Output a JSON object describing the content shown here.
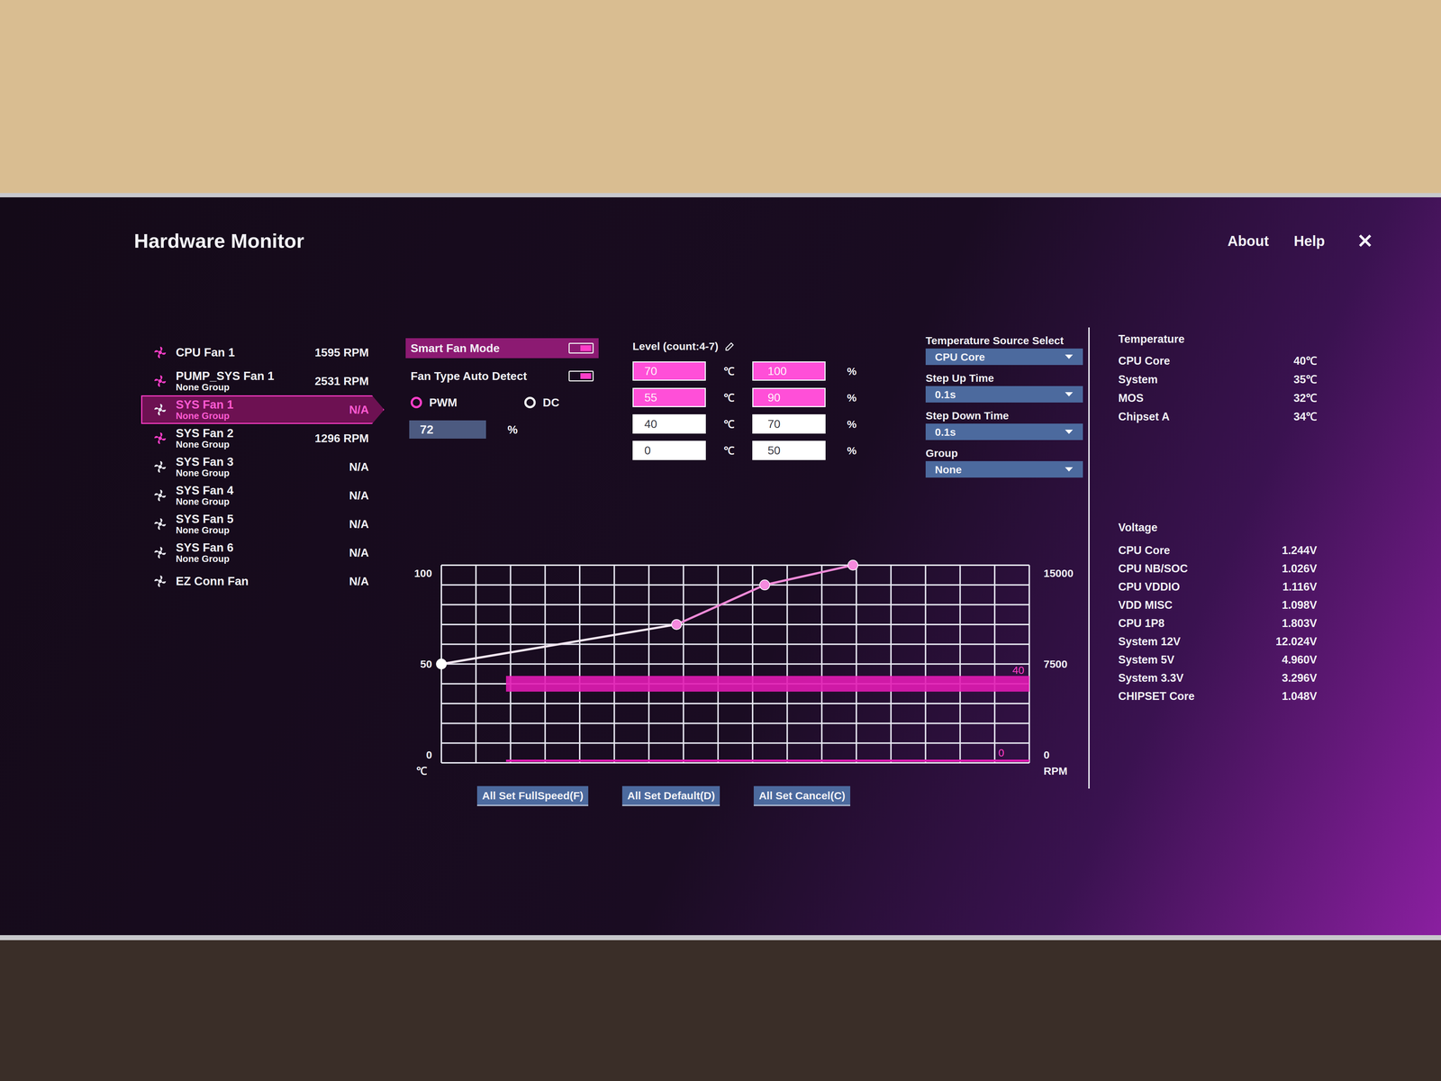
{
  "window": {
    "title": "Hardware Monitor",
    "links": [
      "About",
      "Help"
    ],
    "close": "✕"
  },
  "fans": [
    {
      "name": "CPU Fan 1",
      "group": "",
      "rpm": "1595 RPM",
      "detected": true,
      "selected": false
    },
    {
      "name": "PUMP_SYS Fan 1",
      "group": "None Group",
      "rpm": "2531 RPM",
      "detected": true,
      "selected": false
    },
    {
      "name": "SYS Fan 1",
      "group": "None Group",
      "rpm": "N/A",
      "detected": false,
      "selected": true
    },
    {
      "name": "SYS Fan 2",
      "group": "None Group",
      "rpm": "1296 RPM",
      "detected": true,
      "selected": false
    },
    {
      "name": "SYS Fan 3",
      "group": "None Group",
      "rpm": "N/A",
      "detected": false,
      "selected": false
    },
    {
      "name": "SYS Fan 4",
      "group": "None Group",
      "rpm": "N/A",
      "detected": false,
      "selected": false
    },
    {
      "name": "SYS Fan 5",
      "group": "None Group",
      "rpm": "N/A",
      "detected": false,
      "selected": false
    },
    {
      "name": "SYS Fan 6",
      "group": "None Group",
      "rpm": "N/A",
      "detected": false,
      "selected": false
    },
    {
      "name": "EZ Conn Fan",
      "group": "",
      "rpm": "N/A",
      "detected": false,
      "selected": false
    }
  ],
  "fan_mode": {
    "smart_fan_mode": {
      "label": "Smart Fan Mode",
      "on": true
    },
    "auto_detect": {
      "label": "Fan Type Auto Detect",
      "on": true
    },
    "types": [
      {
        "label": "PWM",
        "selected": true
      },
      {
        "label": "DC",
        "selected": false
      }
    ],
    "percent": "72",
    "percent_unit": "%"
  },
  "levels": {
    "header": "Level (count:4-7)",
    "temp_unit": "℃",
    "pct_unit": "%",
    "rows": [
      {
        "temp": "70",
        "percent": "100",
        "highlighted": true
      },
      {
        "temp": "55",
        "percent": "90",
        "highlighted": true
      },
      {
        "temp": "40",
        "percent": "70",
        "highlighted": false
      },
      {
        "temp": "0",
        "percent": "50",
        "highlighted": false
      }
    ]
  },
  "selects": [
    {
      "label": "Temperature Source Select",
      "value": "CPU Core"
    },
    {
      "label": "Step Up Time",
      "value": "0.1s"
    },
    {
      "label": "Step Down Time",
      "value": "0.1s"
    },
    {
      "label": "Group",
      "value": "None"
    }
  ],
  "temperature": {
    "title": "Temperature",
    "items": [
      {
        "name": "CPU Core",
        "value": "40℃"
      },
      {
        "name": "System",
        "value": "35℃"
      },
      {
        "name": "MOS",
        "value": "32℃"
      },
      {
        "name": "Chipset A",
        "value": "34℃"
      }
    ]
  },
  "voltage": {
    "title": "Voltage",
    "items": [
      {
        "name": "CPU Core",
        "value": "1.244V"
      },
      {
        "name": "CPU NB/SOC",
        "value": "1.026V"
      },
      {
        "name": "CPU VDDIO",
        "value": "1.116V"
      },
      {
        "name": "VDD MISC",
        "value": "1.098V"
      },
      {
        "name": "CPU 1P8",
        "value": "1.803V"
      },
      {
        "name": "System 12V",
        "value": "12.024V"
      },
      {
        "name": "System 5V",
        "value": "4.960V"
      },
      {
        "name": "System 3.3V",
        "value": "3.296V"
      },
      {
        "name": "CHIPSET Core",
        "value": "1.048V"
      }
    ]
  },
  "chart": {
    "y_left_ticks": [
      "100",
      "50",
      "0"
    ],
    "y_left_unit": "℃",
    "y_right_ticks": [
      "15000",
      "7500",
      "0"
    ],
    "y_right_unit": "RPM",
    "curve": {
      "temps": [
        0,
        40,
        55,
        70
      ],
      "percents": [
        50,
        70,
        90,
        100
      ]
    },
    "current_temp": 40,
    "current_temp_label": "40",
    "current_rpm": 0,
    "current_rpm_label": "0"
  },
  "buttons": [
    "All Set FullSpeed(F)",
    "All Set Default(D)",
    "All Set Cancel(C)"
  ]
}
